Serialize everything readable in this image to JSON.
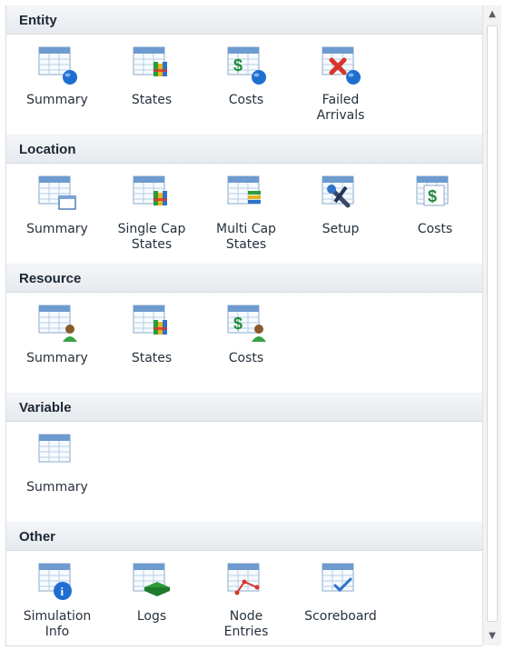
{
  "sections": [
    {
      "title": "Entity",
      "items": [
        {
          "label": "Summary",
          "icon": "summary-table-globe-icon"
        },
        {
          "label": "States",
          "icon": "states-bars-icon"
        },
        {
          "label": "Costs",
          "icon": "costs-dollar-globe-icon"
        },
        {
          "label": "Failed\nArrivals",
          "icon": "failed-arrivals-x-icon"
        }
      ]
    },
    {
      "title": "Location",
      "items": [
        {
          "label": "Summary",
          "icon": "summary-table-window-icon"
        },
        {
          "label": "Single Cap\nStates",
          "icon": "single-cap-states-icon"
        },
        {
          "label": "Multi Cap\nStates",
          "icon": "multi-cap-states-icon"
        },
        {
          "label": "Setup",
          "icon": "setup-wrench-icon"
        },
        {
          "label": "Costs",
          "icon": "costs-dollar-icon"
        }
      ]
    },
    {
      "title": "Resource",
      "items": [
        {
          "label": "Summary",
          "icon": "summary-person-icon"
        },
        {
          "label": "States",
          "icon": "states-bars-icon"
        },
        {
          "label": "Costs",
          "icon": "costs-dollar-person-icon"
        }
      ]
    },
    {
      "title": "Variable",
      "items": [
        {
          "label": "Summary",
          "icon": "summary-table-icon"
        }
      ]
    },
    {
      "title": "Other",
      "items": [
        {
          "label": "Simulation\nInfo",
          "icon": "info-icon"
        },
        {
          "label": "Logs",
          "icon": "logs-book-icon"
        },
        {
          "label": "Node\nEntries",
          "icon": "node-entries-icon"
        },
        {
          "label": "Scoreboard",
          "icon": "scoreboard-check-icon"
        }
      ]
    }
  ],
  "colors": {
    "header_bg": "#e9edf1",
    "table_header": "#5b8fc6",
    "globe": "#1f6fd1",
    "dollar_green": "#1e8a3a",
    "fail_red": "#d9342b"
  }
}
